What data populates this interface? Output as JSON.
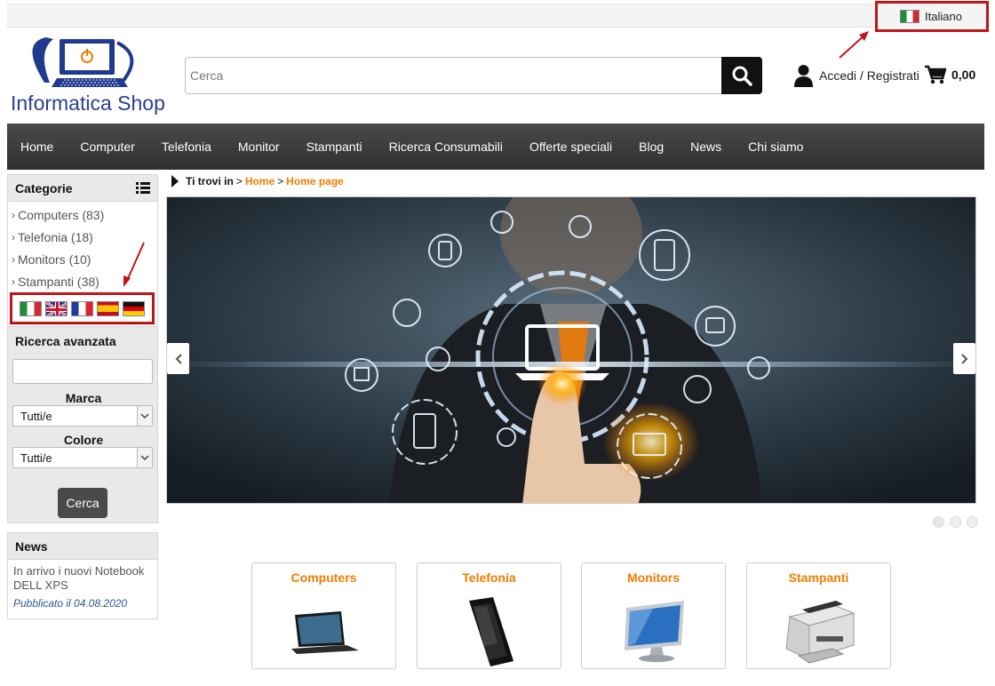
{
  "topbar": {
    "language": "Italiano"
  },
  "header": {
    "logo_text": "Informatica Shop",
    "search_placeholder": "Cerca",
    "account_label": "Accedi / Registrati",
    "cart_total": "0,00"
  },
  "nav": {
    "items": [
      "Home",
      "Computer",
      "Telefonia",
      "Monitor",
      "Stampanti",
      "Ricerca Consumabili",
      "Offerte speciali",
      "Blog",
      "News",
      "Chi siamo"
    ],
    "active": "Home"
  },
  "sidebar": {
    "categories_title": "Categorie",
    "categories": [
      {
        "label": "Computers (83)"
      },
      {
        "label": "Telefonia (18)"
      },
      {
        "label": "Monitors (10)"
      },
      {
        "label": "Stampanti (38)"
      }
    ],
    "flags": [
      "it",
      "gb",
      "fr",
      "es",
      "de"
    ],
    "advanced_search": {
      "title": "Ricerca avanzata",
      "brand_label": "Marca",
      "brand_value": "Tutti/e",
      "color_label": "Colore",
      "color_value": "Tutti/e",
      "button": "Cerca"
    },
    "news": {
      "title": "News",
      "text": "In arrivo i nuovi Notebook DELL XPS",
      "date": "Pubblicato il 04.08.2020"
    }
  },
  "breadcrumb": {
    "prefix": "Ti trovi in",
    "sep1": ">",
    "home": "Home",
    "sep2": ">",
    "current": "Home page"
  },
  "slider": {
    "slides": 3,
    "active_index": 0
  },
  "category_cards": [
    "Computers",
    "Telefonia",
    "Monitors",
    "Stampanti"
  ],
  "colors": {
    "accent": "#f07d00",
    "nav_bg": "#3a3a3a",
    "highlight": "#c0141b",
    "logo_blue": "#2a3f8f"
  }
}
